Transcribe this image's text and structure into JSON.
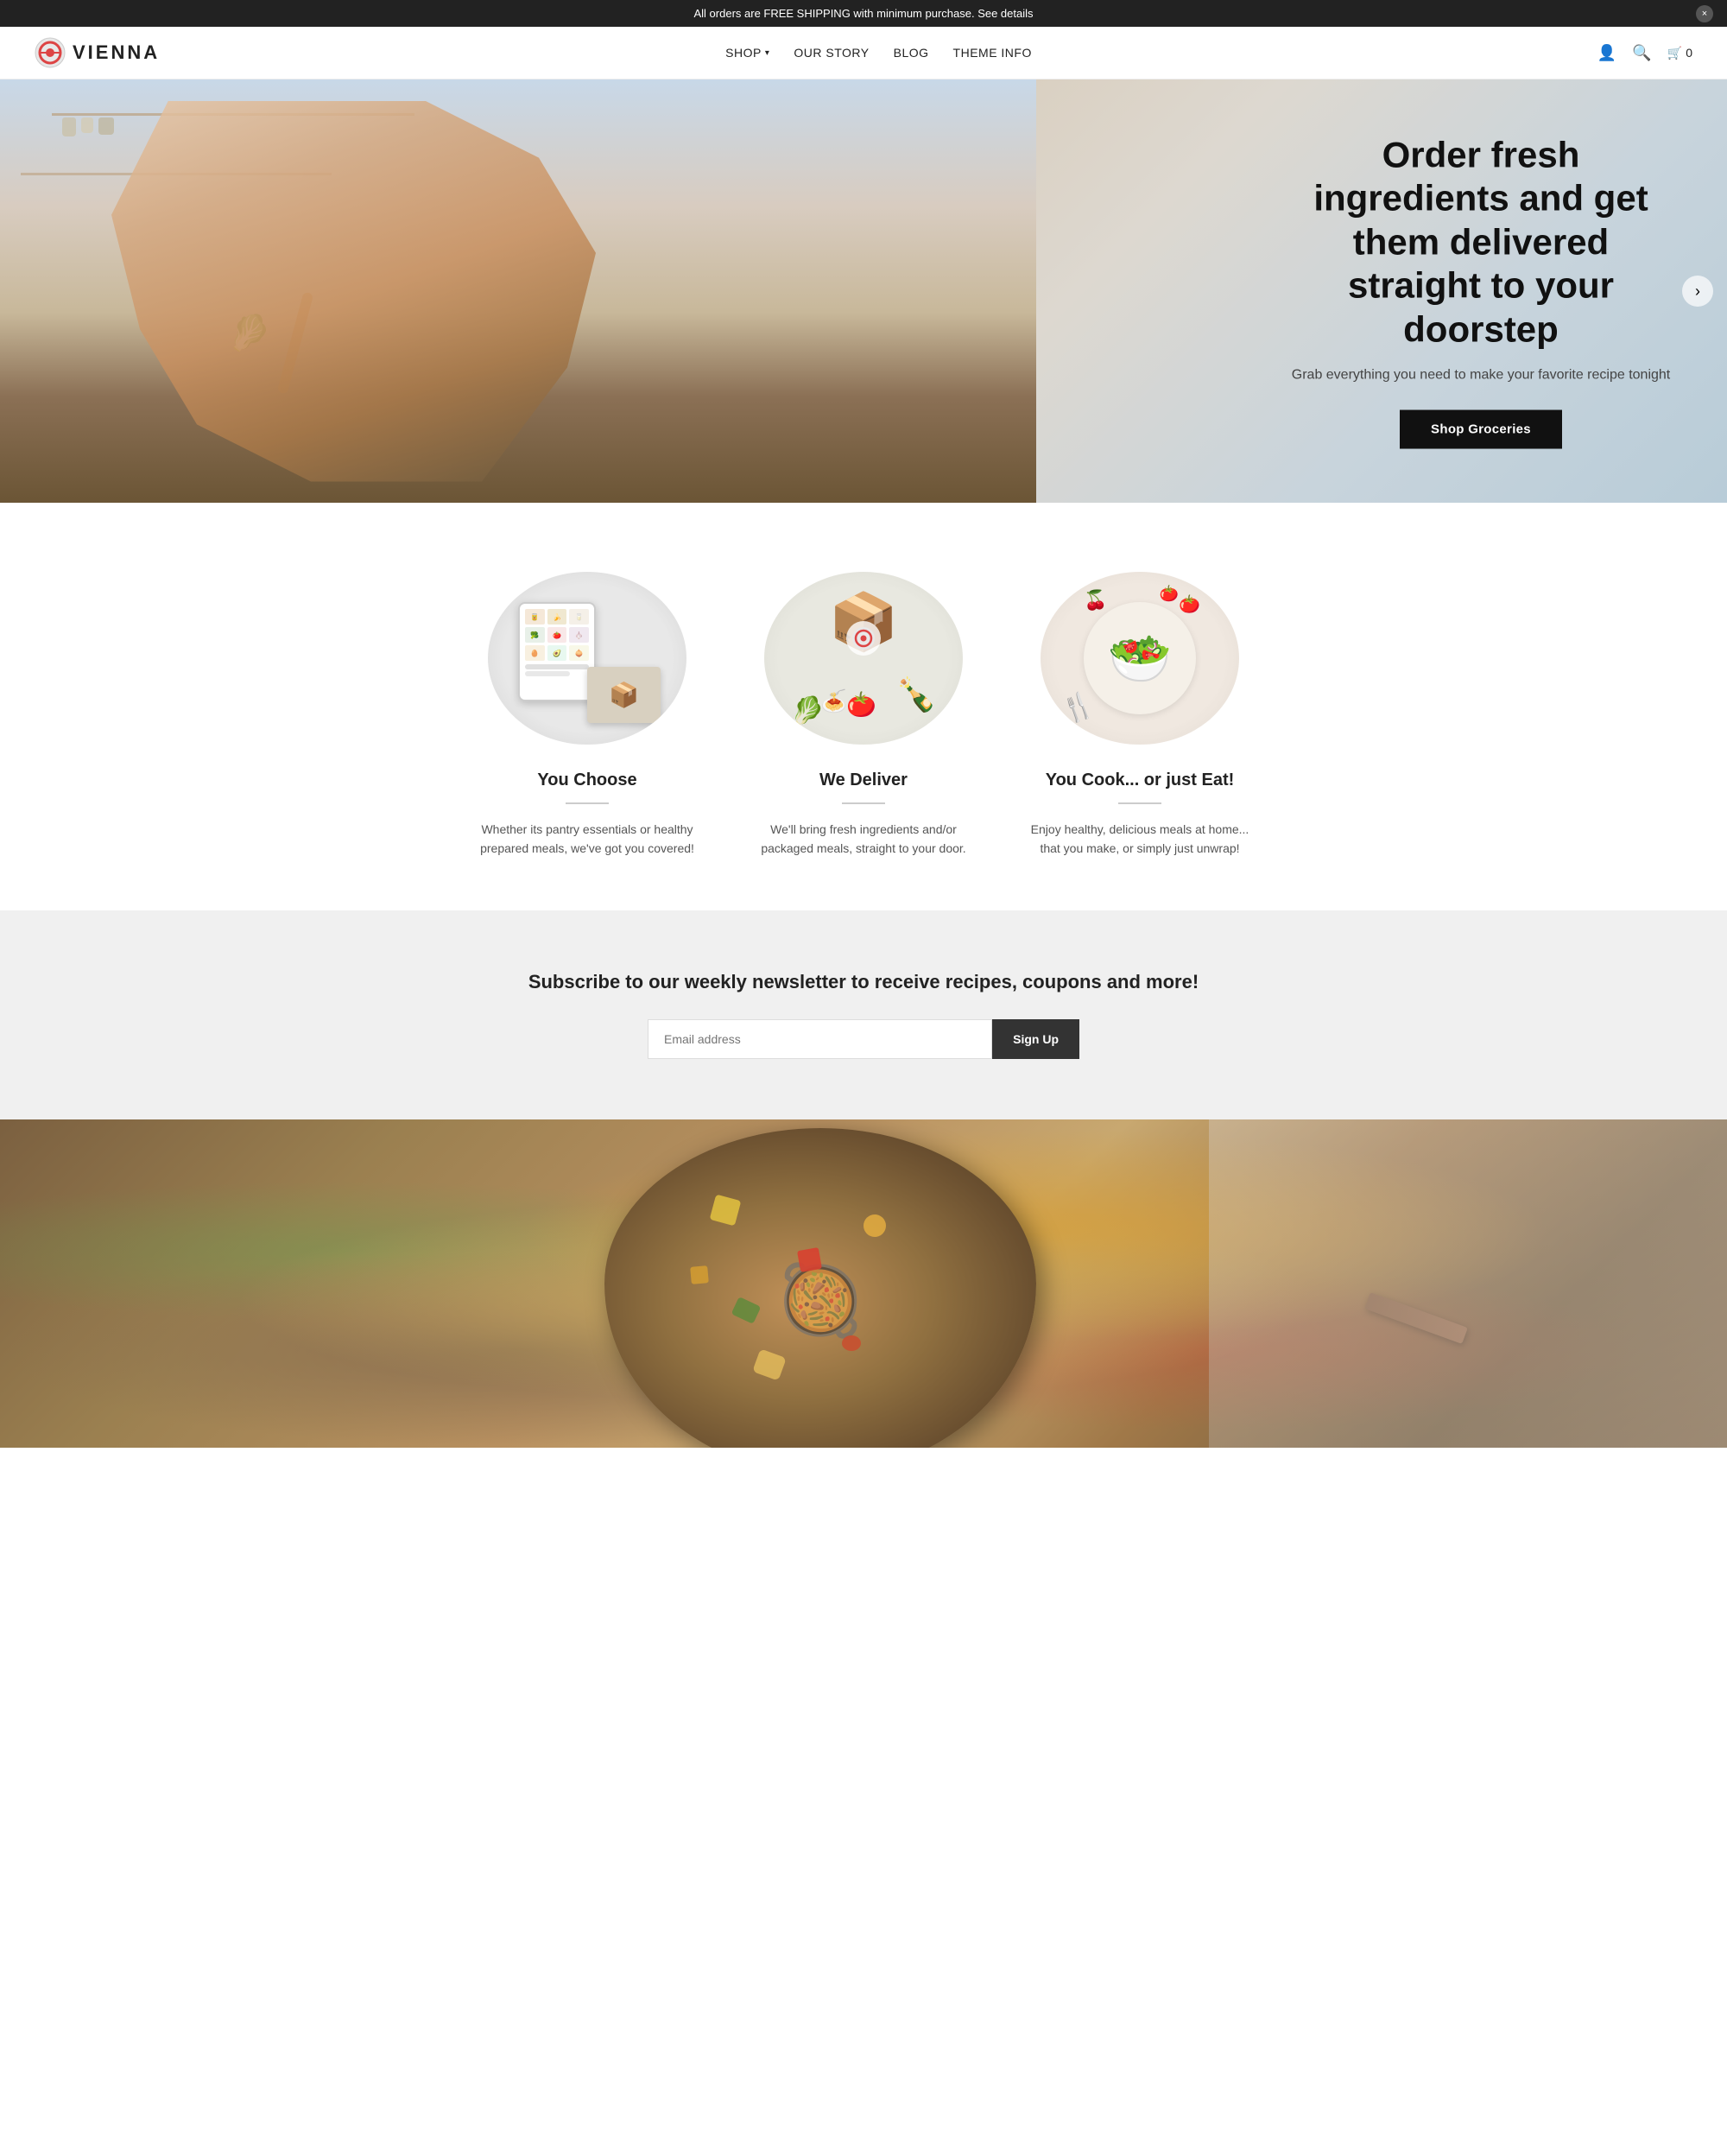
{
  "announcement": {
    "text": "All orders are FREE SHIPPING with minimum purchase. See details",
    "close_label": "×"
  },
  "header": {
    "logo_text": "VIENNA",
    "nav": [
      {
        "label": "SHOP",
        "has_dropdown": true
      },
      {
        "label": "OUR STORY"
      },
      {
        "label": "BLOG"
      },
      {
        "label": "THEME INFO"
      }
    ],
    "cart_label": "0",
    "cart_icon": "🛒"
  },
  "hero": {
    "title": "Order fresh ingredients and get them delivered straight to your doorstep",
    "subtitle": "Grab everything you need to make your favorite recipe tonight",
    "cta_label": "Shop Groceries"
  },
  "features": [
    {
      "title": "You Choose",
      "description": "Whether its pantry essentials or healthy prepared meals, we've got you covered!"
    },
    {
      "title": "We Deliver",
      "description": "We'll bring fresh ingredients and/or packaged meals, straight to your door."
    },
    {
      "title": "You Cook... or just Eat!",
      "description": "Enjoy healthy, delicious meals at home... that you make, or simply just unwrap!"
    }
  ],
  "newsletter": {
    "title": "Subscribe to our weekly newsletter to receive recipes, coupons and more!",
    "input_placeholder": "Email address",
    "button_label": "Sign Up"
  },
  "colors": {
    "primary": "#111111",
    "accent": "#333333",
    "light_bg": "#f0f0f0"
  }
}
